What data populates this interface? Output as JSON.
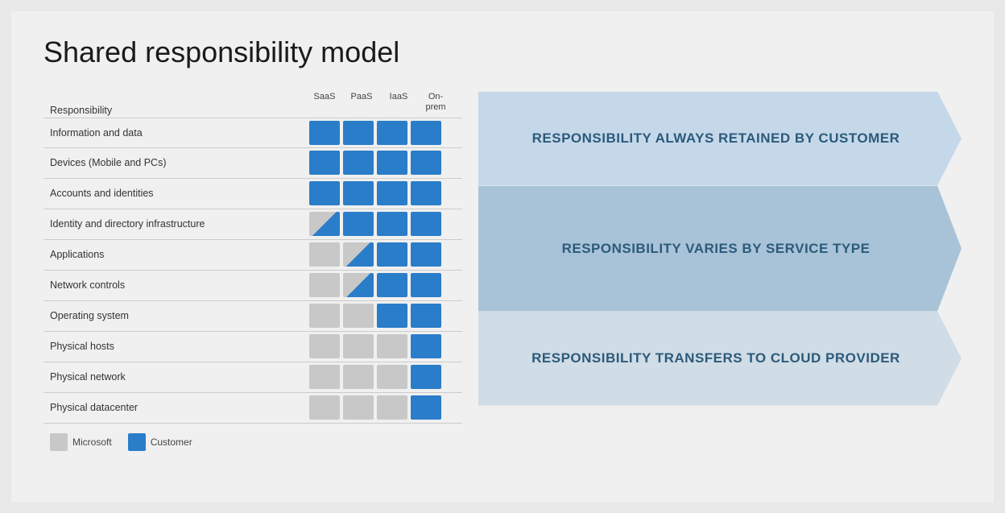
{
  "title": "Shared responsibility model",
  "table": {
    "col_headers": [
      "SaaS",
      "PaaS",
      "IaaS",
      "On-\nprem"
    ],
    "rows": [
      {
        "label": "Information and data",
        "cells": [
          "blue",
          "blue",
          "blue",
          "blue"
        ]
      },
      {
        "label": "Devices (Mobile and PCs)",
        "cells": [
          "blue",
          "blue",
          "blue",
          "blue"
        ]
      },
      {
        "label": "Accounts and identities",
        "cells": [
          "blue",
          "blue",
          "blue",
          "blue"
        ]
      },
      {
        "label": "Identity and directory infrastructure",
        "cells": [
          "half-blue-tr",
          "blue",
          "blue",
          "blue"
        ]
      },
      {
        "label": "Applications",
        "cells": [
          "gray",
          "half-blue-tr",
          "blue",
          "blue"
        ]
      },
      {
        "label": "Network controls",
        "cells": [
          "gray",
          "half-blue-tr",
          "blue",
          "blue"
        ]
      },
      {
        "label": "Operating system",
        "cells": [
          "gray",
          "gray",
          "blue",
          "blue"
        ]
      },
      {
        "label": "Physical hosts",
        "cells": [
          "gray",
          "gray",
          "gray",
          "blue"
        ]
      },
      {
        "label": "Physical network",
        "cells": [
          "gray",
          "gray",
          "gray",
          "blue"
        ]
      },
      {
        "label": "Physical datacenter",
        "cells": [
          "gray",
          "gray",
          "gray",
          "blue"
        ]
      }
    ]
  },
  "arrows": [
    {
      "text": "RESPONSIBILITY ALWAYS RETAINED BY CUSTOMER",
      "color": "light-blue",
      "rows": 3
    },
    {
      "text": "RESPONSIBILITY VARIES BY SERVICE TYPE",
      "color": "mid-blue",
      "rows": 4
    },
    {
      "text": "RESPONSIBILITY TRANSFERS TO CLOUD PROVIDER",
      "color": "pale-blue",
      "rows": 3
    }
  ],
  "legend": {
    "items": [
      {
        "label": "Microsoft",
        "color": "gray"
      },
      {
        "label": "Customer",
        "color": "blue"
      }
    ]
  },
  "header_label": "Responsibility"
}
